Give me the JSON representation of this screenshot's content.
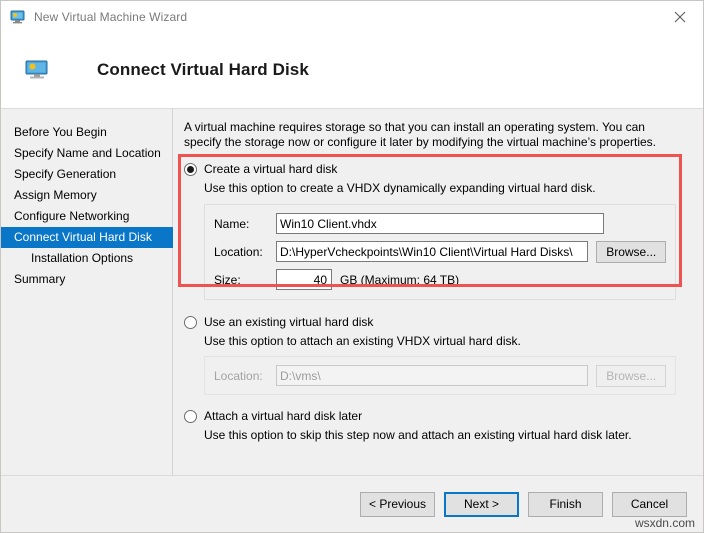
{
  "window": {
    "title": "New Virtual Machine Wizard",
    "icon": "virtual-machine-icon",
    "close_label": "✕"
  },
  "header": {
    "title": "Connect Virtual Hard Disk",
    "icon": "virtual-machine-icon"
  },
  "sidebar": {
    "items": [
      {
        "label": "Before You Begin",
        "selected": false,
        "indent": false
      },
      {
        "label": "Specify Name and Location",
        "selected": false,
        "indent": false
      },
      {
        "label": "Specify Generation",
        "selected": false,
        "indent": false
      },
      {
        "label": "Assign Memory",
        "selected": false,
        "indent": false
      },
      {
        "label": "Configure Networking",
        "selected": false,
        "indent": false
      },
      {
        "label": "Connect Virtual Hard Disk",
        "selected": true,
        "indent": false
      },
      {
        "label": "Installation Options",
        "selected": false,
        "indent": true
      },
      {
        "label": "Summary",
        "selected": false,
        "indent": false
      }
    ],
    "selected_color": "#0a76c8"
  },
  "main": {
    "intro": "A virtual machine requires storage so that you can install an operating system. You can specify the storage now or configure it later by modifying the virtual machine’s properties.",
    "highlight_color": "#ef5350",
    "options": [
      {
        "id": "create-virtual-hard-disk",
        "label": "Create a virtual hard disk",
        "description": "Use this option to create a VHDX dynamically expanding virtual hard disk.",
        "selected": true
      },
      {
        "id": "use-existing-virtual-hard-disk",
        "label": "Use an existing virtual hard disk",
        "description": "Use this option to attach an existing VHDX virtual hard disk.",
        "selected": false
      },
      {
        "id": "attach-virtual-hard-disk-later",
        "label": "Attach a virtual hard disk later",
        "description": "Use this option to skip this step now and attach an existing virtual hard disk later.",
        "selected": false
      }
    ],
    "create_form": {
      "name_label": "Name:",
      "name_value": "Win10 Client.vhdx",
      "location_label": "Location:",
      "location_value": "D:\\HyperVcheckpoints\\Win10 Client\\Virtual Hard Disks\\",
      "browse_label": "Browse...",
      "size_label": "Size:",
      "size_value": "40",
      "size_unit": "GB (Maximum: 64 TB)"
    },
    "existing_form": {
      "location_label": "Location:",
      "location_value": "D:\\vms\\",
      "browse_label": "Browse..."
    }
  },
  "footer": {
    "previous_label": "< Previous",
    "next_label": "Next >",
    "finish_label": "Finish",
    "cancel_label": "Cancel",
    "watermark": "wsxdn.com"
  }
}
